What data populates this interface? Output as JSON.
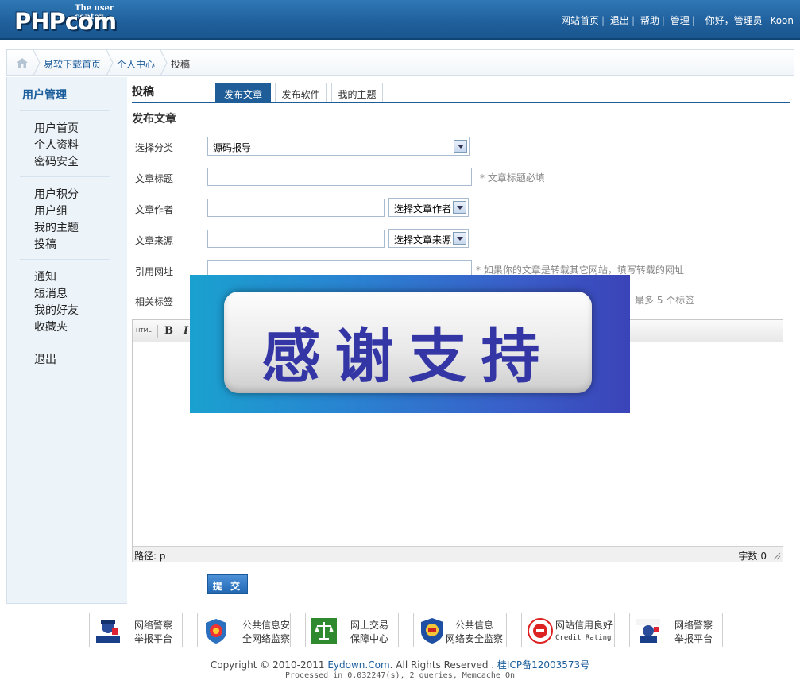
{
  "header": {
    "logo_tag": "The user center",
    "logo_text": "PHPcom",
    "links": [
      "网站首页",
      "退出",
      "帮助",
      "管理"
    ],
    "greeting": "你好，管理员",
    "user": "Koon"
  },
  "breadcrumb": {
    "items": [
      "易软下载首页",
      "个人中心",
      "投稿"
    ]
  },
  "sidebar": {
    "title": "用户管理",
    "groups": [
      [
        "用户首页",
        "个人资料",
        "密码安全"
      ],
      [
        "用户积分",
        "用户组",
        "我的主题",
        "投稿"
      ],
      [
        "通知",
        "短消息",
        "我的好友",
        "收藏夹"
      ],
      [
        "退出"
      ]
    ]
  },
  "main": {
    "title": "投稿",
    "tabs": [
      "发布文章",
      "发布软件",
      "我的主题"
    ],
    "active_tab": "发布文章",
    "section_title": "发布文章"
  },
  "form": {
    "category_label": "选择分类",
    "category_value": "源码报导",
    "title_label": "文章标题",
    "title_hint": "* 文章标题必填",
    "author_label": "文章作者",
    "author_select": "选择文章作者",
    "source_label": "文章来源",
    "source_select": "选择文章来源",
    "url_label": "引用网址",
    "url_hint": "* 如果你的文章是转载其它网站，填写转载的网址",
    "tags_label": "相关标签",
    "tags_hint": "最多 5 个标签",
    "submit_label": "提 交"
  },
  "editor": {
    "html_label": "HTML",
    "bold_label": "B",
    "italic_label": "I",
    "path_label": "路径: p",
    "count_label": "字数:0"
  },
  "banner": {
    "text": "感谢支持"
  },
  "footer": {
    "badges": [
      {
        "line1": "网络警察",
        "line2": "举报平台",
        "icon": "police-icon"
      },
      {
        "line1": "公共信息安",
        "line2": "全网络监察",
        "icon": "shield-icon"
      },
      {
        "line1": "网上交易",
        "line2": "保障中心",
        "icon": "scales-icon"
      },
      {
        "line1": "公共信息",
        "line2": "网络安全监察",
        "icon": "emblem-icon"
      },
      {
        "line1": "网站信用良好",
        "line2": "Credit Rating",
        "icon": "credit-seal-icon"
      },
      {
        "line1": "网络警察",
        "line2": "举报平台",
        "icon": "police-report-icon"
      }
    ],
    "copyright_prefix": "Copyright © 2010-2011 ",
    "copyright_site": "Eydown.Com",
    "copyright_mid": ". All Rights Reserved . ",
    "icp": "桂ICP备12003573号",
    "processed": "Processed in 0.032247(s), 2 queries, Memcache On"
  },
  "colors": {
    "header_blue": "#1f5f9b",
    "link_blue": "#1b5d9b",
    "tab_active": "#1e5d98",
    "banner_text": "#3436a6"
  }
}
